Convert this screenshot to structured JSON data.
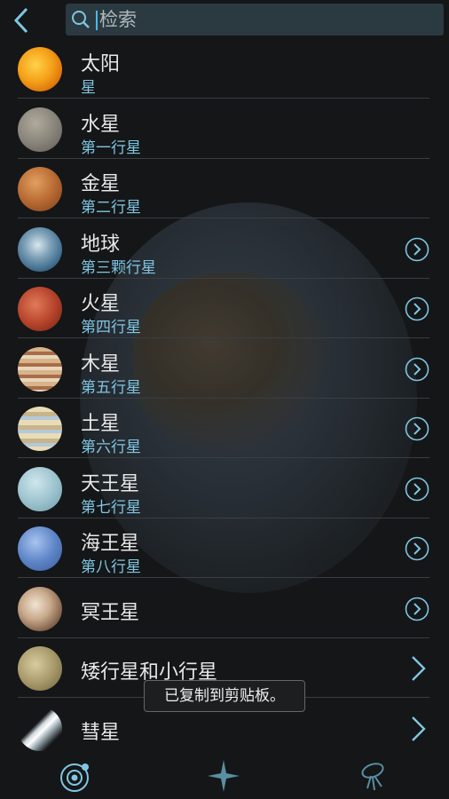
{
  "search": {
    "placeholder": "检索"
  },
  "items": [
    {
      "name": "太阳",
      "subtitle": "星",
      "arrow": "none"
    },
    {
      "name": "水星",
      "subtitle": "第一行星",
      "arrow": "none"
    },
    {
      "name": "金星",
      "subtitle": "第二行星",
      "arrow": "none"
    },
    {
      "name": "地球",
      "subtitle": "第三颗行星",
      "arrow": "circle"
    },
    {
      "name": "火星",
      "subtitle": "第四行星",
      "arrow": "circle"
    },
    {
      "name": "木星",
      "subtitle": "第五行星",
      "arrow": "circle"
    },
    {
      "name": "土星",
      "subtitle": "第六行星",
      "arrow": "circle"
    },
    {
      "name": "天王星",
      "subtitle": "第七行星",
      "arrow": "circle"
    },
    {
      "name": "海王星",
      "subtitle": "第八行星",
      "arrow": "circle"
    },
    {
      "name": "冥王星",
      "subtitle": "",
      "arrow": "circle"
    },
    {
      "name": "矮行星和小行星",
      "subtitle": "",
      "arrow": "plain"
    },
    {
      "name": "彗星",
      "subtitle": "",
      "arrow": "plain"
    }
  ],
  "toast": "已复制到剪贴板。",
  "icons": {
    "back": "chevron-left-icon",
    "search": "search-icon",
    "planet_go": "circle-chevron-right-icon",
    "plain_go": "chevron-right-icon",
    "tab_solar": "solar-system-icon",
    "tab_stars": "star-icon",
    "tab_probe": "spacecraft-icon"
  },
  "colors": {
    "accent": "#7fc6e2",
    "background": "#141618",
    "search_bg": "#2b3a40"
  }
}
